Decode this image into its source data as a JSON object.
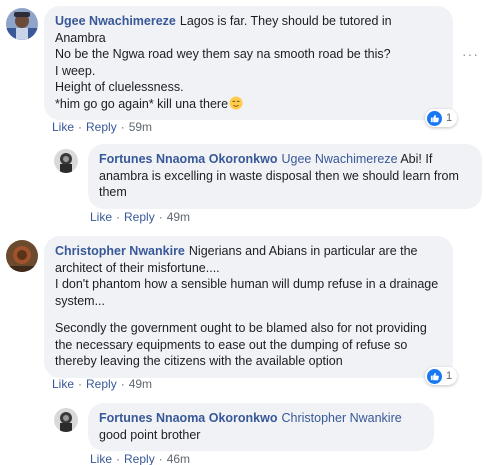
{
  "comments": [
    {
      "author": "Ugee Nwachimereze",
      "lines": [
        "Lagos is far. They should be tutored in Anambra",
        "No be the Ngwa road wey them say na smooth road be this?",
        "I weep.",
        "Height of cluelessness.",
        "*him go go again* kill una there"
      ],
      "emoji": "relieved-face-emoji",
      "actions": {
        "like": "Like",
        "reply": "Reply",
        "time": "59m"
      },
      "reaction_count": "1",
      "more": "···"
    },
    {
      "author": "Fortunes Nnaoma Okoronkwo",
      "mention": "Ugee Nwachimereze",
      "text": "Abi! If anambra is excelling in waste disposal then we should learn from them",
      "actions": {
        "like": "Like",
        "reply": "Reply",
        "time": "49m"
      }
    },
    {
      "author": "Christopher Nwankire",
      "paragraphs": [
        "Nigerians and Abians in particular are the architect of their misfortune....",
        "I don't phantom how a sensible human will dump refuse in a drainage system...",
        "Secondly the government ought to be blamed also for not providing the necessary equipments to ease out the dumping of refuse so thereby leaving the citizens with the available option"
      ],
      "actions": {
        "like": "Like",
        "reply": "Reply",
        "time": "49m"
      },
      "reaction_count": "1"
    },
    {
      "author": "Fortunes Nnaoma Okoronkwo",
      "mention": "Christopher Nwankire",
      "text": "good point brother",
      "actions": {
        "like": "Like",
        "reply": "Reply",
        "time": "46m"
      }
    }
  ],
  "colors": {
    "link": "#385898",
    "bubble": "#f0f2f5",
    "like_blue": "#1877f2",
    "meta": "#606770"
  },
  "icons": [
    "like-reaction-icon",
    "more-options-icon",
    "avatar"
  ]
}
